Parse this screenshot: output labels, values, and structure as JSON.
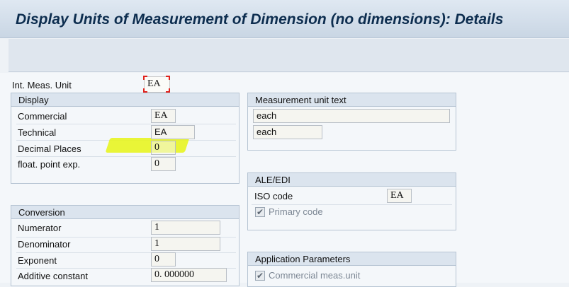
{
  "window": {
    "title": "Display Units of Measurement of Dimension (no dimensions): Details"
  },
  "header_field": {
    "label": "Int. Meas. Unit",
    "value": "EA"
  },
  "display": {
    "title": "Display",
    "commercial_label": "Commercial",
    "commercial_value": "EA",
    "technical_label": "Technical",
    "technical_value": "EA",
    "decimal_label": "Decimal Places",
    "decimal_value": "0",
    "float_label": "float. point exp.",
    "float_value": "0"
  },
  "measurement_text": {
    "title": "Measurement unit text",
    "long_text": "each",
    "short_text": "each"
  },
  "ale_edi": {
    "title": "ALE/EDI",
    "iso_label": "ISO code",
    "iso_value": "EA",
    "primary_label": "Primary code",
    "primary_checked": true
  },
  "conversion": {
    "title": "Conversion",
    "numerator_label": "Numerator",
    "numerator_value": "1",
    "denominator_label": "Denominator",
    "denominator_value": "1",
    "exponent_label": "Exponent",
    "exponent_value": "0",
    "additive_label": "Additive constant",
    "additive_value": "0. 000000"
  },
  "app_params": {
    "title": "Application Parameters",
    "commercial_label": "Commercial meas.unit",
    "commercial_checked": true
  },
  "colors": {
    "highlight": "#e6f514",
    "focus_marker": "#e0221d",
    "title_text": "#0d2d4f"
  }
}
